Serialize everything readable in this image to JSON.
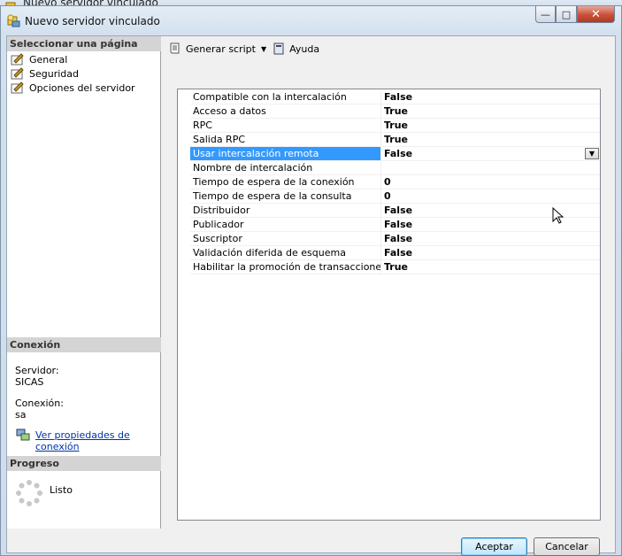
{
  "back_window": {
    "title": "Nuevo servidor vinculado"
  },
  "window": {
    "title": "Nuevo servidor vinculado",
    "controls": {
      "minimize": "—",
      "maximize": "□",
      "close": "✕"
    }
  },
  "left_pane": {
    "select_page_header": "Seleccionar una página",
    "pages": [
      {
        "label": "General",
        "icon": "page-wrench-icon"
      },
      {
        "label": "Seguridad",
        "icon": "page-wrench-icon"
      },
      {
        "label": "Opciones del servidor",
        "icon": "page-wrench-icon"
      }
    ],
    "connection_header": "Conexión",
    "server_label": "Servidor:",
    "server_value": "SICAS",
    "connection_label": "Conexión:",
    "connection_value": "sa",
    "view_properties_link": "Ver propiedades de conexión",
    "progress_header": "Progreso",
    "progress_status": "Listo"
  },
  "toolbar": {
    "generate_script": "Generar script",
    "help": "Ayuda"
  },
  "properties": [
    {
      "name": "Compatible con la intercalación",
      "value": "False"
    },
    {
      "name": "Acceso a datos",
      "value": "True"
    },
    {
      "name": "RPC",
      "value": "True"
    },
    {
      "name": "Salida RPC",
      "value": "True"
    },
    {
      "name": "Usar intercalación remota",
      "value": "False",
      "selected": true
    },
    {
      "name": "Nombre de intercalación",
      "value": ""
    },
    {
      "name": "Tiempo de espera de la conexión",
      "value": "0"
    },
    {
      "name": "Tiempo de espera de la consulta",
      "value": "0"
    },
    {
      "name": "Distribuidor",
      "value": "False"
    },
    {
      "name": "Publicador",
      "value": "False"
    },
    {
      "name": "Suscriptor",
      "value": "False"
    },
    {
      "name": "Validación diferida de esquema",
      "value": "False"
    },
    {
      "name": "Habilitar la promoción de transacciones distril",
      "value": "True"
    }
  ],
  "buttons": {
    "ok": "Aceptar",
    "cancel": "Cancelar"
  },
  "colors": {
    "selection": "#3399ff",
    "link": "#0033aa"
  }
}
